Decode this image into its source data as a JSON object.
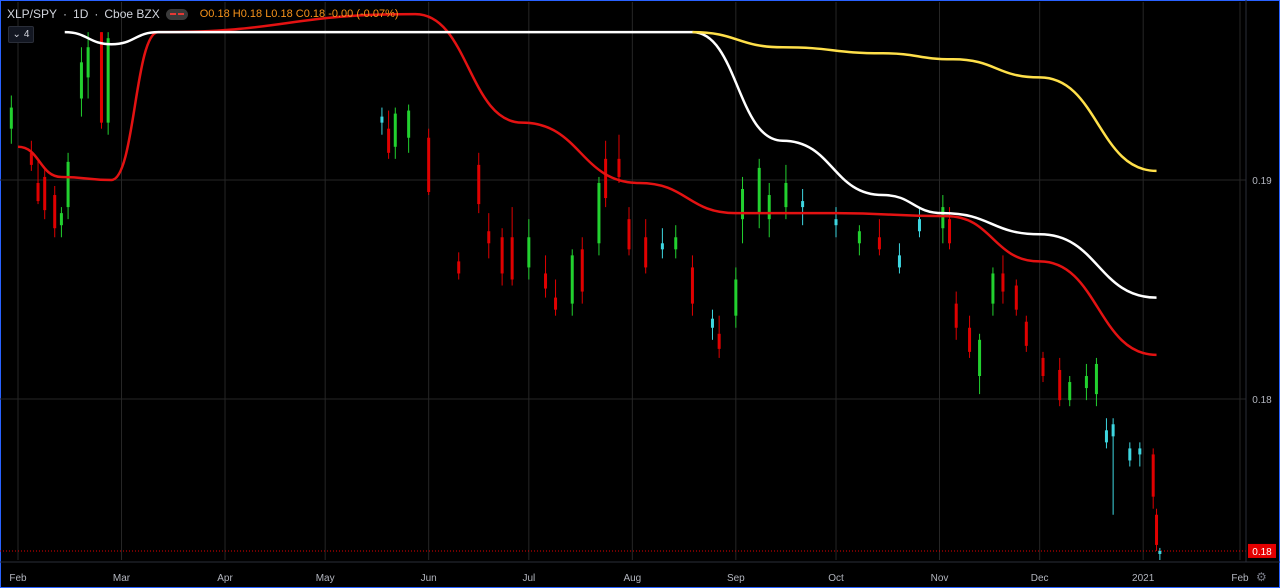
{
  "header": {
    "symbol": "XLP/SPY",
    "interval": "1D",
    "exchange": "Cboe BZX",
    "ohlc": {
      "o": "O0.18",
      "h": "H0.18",
      "l": "L0.18",
      "c": "C0.18",
      "change": "-0.00 (-0.07%)"
    },
    "indicator_count": "4"
  },
  "icons": {
    "collapse": "chevron-down-icon",
    "visibility": "eye-icon",
    "settings": "gear-icon"
  },
  "colors": {
    "background": "#000000",
    "up": "#22d12f",
    "down": "#e00000",
    "doji": "#3ed6e0",
    "ma_fast": "#e31212",
    "ma_mid": "#ffffff",
    "ma_slow": "#ffe04a",
    "grid": "#262626",
    "axis_text": "#b2b5be",
    "price_tag": "#e50000",
    "frame": "#2962ff"
  },
  "chart_data": {
    "type": "candlestick",
    "title": "XLP/SPY · 1D · Cboe BZX",
    "xlabel": "",
    "ylabel": "",
    "x_ticks": [
      "Feb",
      "Mar",
      "Apr",
      "May",
      "Jun",
      "Jul",
      "Aug",
      "Sep",
      "Oct",
      "Nov",
      "Dec",
      "2021",
      "Feb"
    ],
    "y_ticks": [
      "0.19",
      "0.18"
    ],
    "last_price_label": "0.18",
    "ylim_approx": [
      0.1745,
      0.193
    ],
    "grid": true,
    "series": [
      {
        "name": "",
        "kind": "moving-average",
        "color": "#e31212",
        "points": [
          [
            "2020-01-30",
            0.1882
          ],
          [
            "2020-02-12",
            0.1872
          ],
          [
            "2020-02-27",
            0.1871
          ],
          [
            "2020-03-12",
            0.192
          ],
          [
            "2020-05-28",
            0.1926
          ],
          [
            "2020-06-29",
            0.189
          ],
          [
            "2020-08-03",
            0.187
          ],
          [
            "2020-09-01",
            0.186
          ],
          [
            "2020-10-01",
            0.186
          ],
          [
            "2020-11-03",
            0.1859
          ],
          [
            "2020-12-01",
            0.1844
          ],
          [
            "2021-01-05",
            0.1813
          ]
        ]
      },
      {
        "name": "",
        "kind": "moving-average",
        "color": "#ffffff",
        "points": [
          [
            "2020-02-13",
            0.192
          ],
          [
            "2020-02-27",
            0.1916
          ],
          [
            "2020-03-12",
            0.192
          ],
          [
            "2020-08-19",
            0.192
          ],
          [
            "2020-09-15",
            0.1884
          ],
          [
            "2020-10-15",
            0.1866
          ],
          [
            "2020-11-02",
            0.186
          ],
          [
            "2020-12-01",
            0.1853
          ],
          [
            "2021-01-05",
            0.1832
          ]
        ]
      },
      {
        "name": "",
        "kind": "moving-average",
        "color": "#ffe04a",
        "points": [
          [
            "2020-08-19",
            0.192
          ],
          [
            "2020-09-15",
            0.1915
          ],
          [
            "2020-10-15",
            0.1913
          ],
          [
            "2020-11-05",
            0.1911
          ],
          [
            "2020-12-01",
            0.1905
          ],
          [
            "2021-01-05",
            0.1874
          ]
        ]
      }
    ],
    "candles": [
      [
        "2020-01-28",
        0.1888,
        0.1899,
        0.1883,
        0.1895
      ],
      [
        "2020-02-03",
        0.188,
        0.1884,
        0.1874,
        0.1876
      ],
      [
        "2020-02-05",
        0.187,
        0.1878,
        0.1863,
        0.1864
      ],
      [
        "2020-02-07",
        0.1872,
        0.1875,
        0.1858,
        0.1861
      ],
      [
        "2020-02-10",
        0.1866,
        0.1869,
        0.1852,
        0.1855
      ],
      [
        "2020-02-12",
        0.1856,
        0.1862,
        0.1852,
        0.186
      ],
      [
        "2020-02-14",
        0.1862,
        0.188,
        0.1858,
        0.1877
      ],
      [
        "2020-02-18",
        0.1898,
        0.1915,
        0.1892,
        0.191
      ],
      [
        "2020-02-20",
        0.1905,
        0.192,
        0.1898,
        0.1915
      ],
      [
        "2020-02-24",
        0.192,
        0.192,
        0.1888,
        0.189
      ],
      [
        "2020-02-26",
        0.189,
        0.192,
        0.1886,
        0.1918
      ],
      [
        "2020-05-18",
        0.189,
        0.1895,
        0.1886,
        0.1892
      ],
      [
        "2020-05-20",
        0.1888,
        0.1894,
        0.1878,
        0.188
      ],
      [
        "2020-05-22",
        0.1882,
        0.1895,
        0.1878,
        0.1893
      ],
      [
        "2020-05-26",
        0.1885,
        0.1896,
        0.188,
        0.1894
      ],
      [
        "2020-06-01",
        0.1885,
        0.1888,
        0.1866,
        0.1867
      ],
      [
        "2020-06-10",
        0.1844,
        0.1847,
        0.1838,
        0.184
      ],
      [
        "2020-06-16",
        0.1876,
        0.188,
        0.186,
        0.1863
      ],
      [
        "2020-06-19",
        0.1854,
        0.186,
        0.1845,
        0.185
      ],
      [
        "2020-06-23",
        0.1852,
        0.1855,
        0.1836,
        0.184
      ],
      [
        "2020-06-26",
        0.1852,
        0.1862,
        0.1836,
        0.1838
      ],
      [
        "2020-07-01",
        0.1842,
        0.1858,
        0.1838,
        0.1852
      ],
      [
        "2020-07-06",
        0.184,
        0.1846,
        0.1832,
        0.1835
      ],
      [
        "2020-07-09",
        0.1832,
        0.1838,
        0.1826,
        0.1828
      ],
      [
        "2020-07-14",
        0.183,
        0.1848,
        0.1826,
        0.1846
      ],
      [
        "2020-07-17",
        0.1848,
        0.1852,
        0.183,
        0.1834
      ],
      [
        "2020-07-22",
        0.185,
        0.1872,
        0.1846,
        0.187
      ],
      [
        "2020-07-24",
        0.1878,
        0.1884,
        0.1862,
        0.1865
      ],
      [
        "2020-07-28",
        0.1878,
        0.1886,
        0.187,
        0.1872
      ],
      [
        "2020-07-31",
        0.1858,
        0.1862,
        0.1846,
        0.1848
      ],
      [
        "2020-08-05",
        0.1852,
        0.1858,
        0.184,
        0.1842
      ],
      [
        "2020-08-10",
        0.185,
        0.1855,
        0.1845,
        0.1848
      ],
      [
        "2020-08-14",
        0.1848,
        0.1856,
        0.1845,
        0.1852
      ],
      [
        "2020-08-19",
        0.1842,
        0.1846,
        0.1826,
        0.183
      ],
      [
        "2020-08-25",
        0.1825,
        0.1828,
        0.1818,
        0.1822
      ],
      [
        "2020-08-27",
        0.182,
        0.1826,
        0.1812,
        0.1815
      ],
      [
        "2020-09-01",
        0.1826,
        0.1842,
        0.1822,
        0.1838
      ],
      [
        "2020-09-03",
        0.1858,
        0.1872,
        0.185,
        0.1868
      ],
      [
        "2020-09-08",
        0.186,
        0.1878,
        0.1855,
        0.1875
      ],
      [
        "2020-09-11",
        0.1858,
        0.187,
        0.1852,
        0.1866
      ],
      [
        "2020-09-16",
        0.1862,
        0.1876,
        0.1858,
        0.187
      ],
      [
        "2020-09-21",
        0.1862,
        0.1868,
        0.1856,
        0.1864
      ],
      [
        "2020-10-01",
        0.1858,
        0.1862,
        0.1852,
        0.1856
      ],
      [
        "2020-10-08",
        0.185,
        0.1856,
        0.1846,
        0.1854
      ],
      [
        "2020-10-14",
        0.1852,
        0.1858,
        0.1846,
        0.1848
      ],
      [
        "2020-10-20",
        0.1846,
        0.185,
        0.184,
        0.1842
      ],
      [
        "2020-10-26",
        0.1858,
        0.1862,
        0.1852,
        0.1854
      ],
      [
        "2020-11-02",
        0.1855,
        0.1866,
        0.185,
        0.1862
      ],
      [
        "2020-11-04",
        0.1858,
        0.1862,
        0.1848,
        0.185
      ],
      [
        "2020-11-06",
        0.183,
        0.1834,
        0.1818,
        0.1822
      ],
      [
        "2020-11-10",
        0.1822,
        0.1826,
        0.1812,
        0.1814
      ],
      [
        "2020-11-13",
        0.1806,
        0.182,
        0.18,
        0.1818
      ],
      [
        "2020-11-17",
        0.183,
        0.1842,
        0.1826,
        0.184
      ],
      [
        "2020-11-20",
        0.184,
        0.1846,
        0.183,
        0.1834
      ],
      [
        "2020-11-24",
        0.1836,
        0.1838,
        0.1826,
        0.1828
      ],
      [
        "2020-11-27",
        0.1824,
        0.1826,
        0.1814,
        0.1816
      ],
      [
        "2020-12-02",
        0.1812,
        0.1814,
        0.1804,
        0.1806
      ],
      [
        "2020-12-07",
        0.1808,
        0.1812,
        0.1796,
        0.1798
      ],
      [
        "2020-12-10",
        0.1798,
        0.1806,
        0.1796,
        0.1804
      ],
      [
        "2020-12-15",
        0.1802,
        0.181,
        0.1798,
        0.1806
      ],
      [
        "2020-12-18",
        0.18,
        0.1812,
        0.1796,
        0.181
      ],
      [
        "2020-12-21",
        0.1788,
        0.1792,
        0.1782,
        0.1784
      ],
      [
        "2020-12-23",
        0.1786,
        0.1792,
        0.176,
        0.179
      ],
      [
        "2020-12-28",
        0.1782,
        0.1784,
        0.1776,
        0.1778
      ],
      [
        "2020-12-31",
        0.1782,
        0.1784,
        0.1776,
        0.178
      ],
      [
        "2021-01-04",
        0.178,
        0.1782,
        0.1762,
        0.1766
      ],
      [
        "2021-01-05",
        0.176,
        0.1762,
        0.1748,
        0.175
      ],
      [
        "2021-01-06",
        0.1747,
        0.1749,
        0.1745,
        0.1748
      ]
    ]
  }
}
